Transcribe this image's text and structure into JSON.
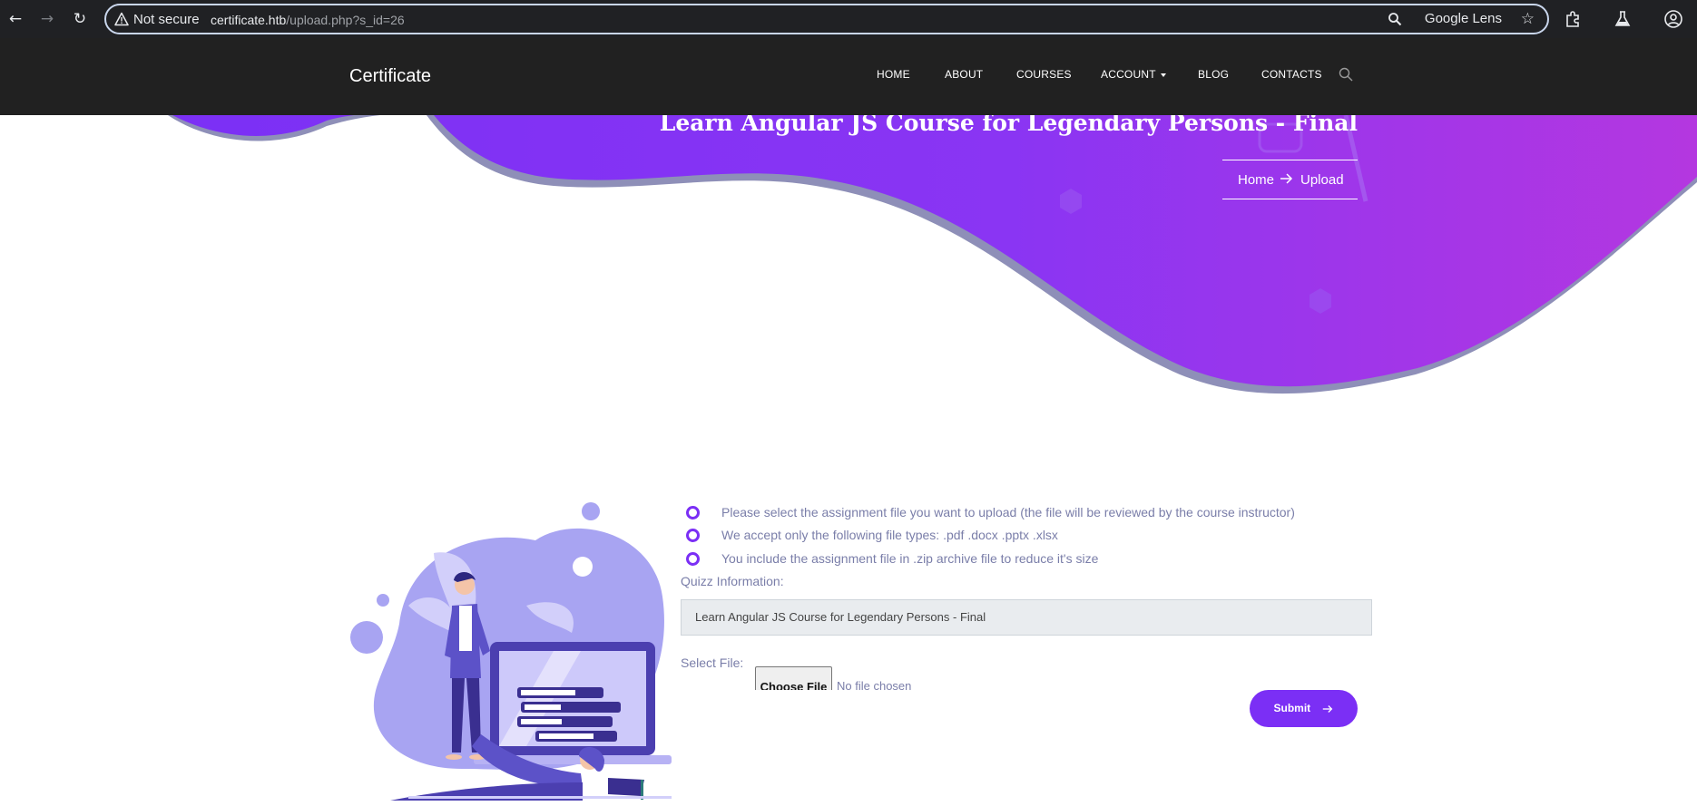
{
  "browser": {
    "not_secure": "Not secure",
    "url_host": "certificate.htb",
    "url_path": "/upload.php?s_id=26",
    "lens_label": "Google Lens",
    "icons": [
      "back-icon",
      "forward-icon",
      "reload-icon",
      "warning-icon",
      "search-icon",
      "star-icon",
      "extensions-icon",
      "labs-icon",
      "profile-icon"
    ]
  },
  "header": {
    "brand": "Certificate",
    "nav": [
      "HOME",
      "ABOUT",
      "COURSES",
      "ACCOUNT",
      "BLOG",
      "CONTACTS"
    ]
  },
  "hero": {
    "title": "Learn Angular JS Course for Legendary Persons - Final",
    "breadcrumb_home": "Home",
    "breadcrumb_current": "Upload"
  },
  "upload": {
    "info": [
      "Please select the assignment file you want to upload (the file will be reviewed by the course instructor)",
      "We accept only the following file types: .pdf .docx .pptx .xlsx",
      "You include the assignment file in .zip archive file to reduce it's size"
    ],
    "quiz_label": "Quizz Information:",
    "quiz_value": "Learn Angular JS Course for Legendary Persons - Final",
    "select_label": "Select File:",
    "choose_button": "Choose File",
    "no_file": "No file chosen",
    "submit_label": "Submit"
  },
  "colors": {
    "accent": "#7b2ff5",
    "header_bg": "#212121",
    "muted_text": "#7a7ea9"
  }
}
